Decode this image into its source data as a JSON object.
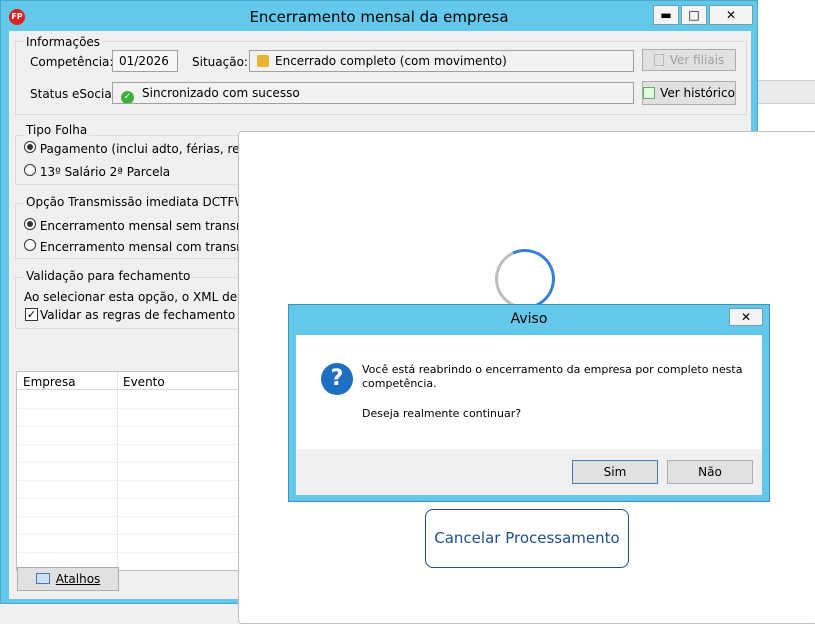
{
  "window": {
    "title": "Encerramento mensal da empresa",
    "minimize": "▬",
    "maximize": "□",
    "close": "✕"
  },
  "info": {
    "group_label": "Informações",
    "competencia_label": "Competência:",
    "competencia_value": "01/2026",
    "situacao_label": "Situação:",
    "situacao_value": "Encerrado completo (com movimento)",
    "ver_filiais": "Ver filiais",
    "status_label": "Status eSocial:",
    "status_value": "Sincronizado com sucesso",
    "ver_historico": "Ver histórico"
  },
  "tipo_folha": {
    "label": "Tipo Folha",
    "option1": "Pagamento (inclui adto, férias, rescisã",
    "option2": "13º Salário 2ª Parcela",
    "selected": 0
  },
  "transmissao": {
    "label": "Opção Transmissão imediata DCTFWeb (",
    "option1": "Encerramento mensal sem transmissã",
    "option2": "Encerramento mensal com transmissã",
    "selected": 0
  },
  "validacao": {
    "label": "Validação para fechamento",
    "text": "Ao selecionar esta opção, o XML de retor",
    "checkbox_label": "Validar as regras de fechamento",
    "checked": true
  },
  "grid": {
    "columns": [
      "Empresa",
      "Evento"
    ]
  },
  "atalhos_label": "Atalhos",
  "overlay": {
    "cancel_label": "Cancelar Processamento"
  },
  "dialog": {
    "title": "Aviso",
    "close": "✕",
    "message_line1": "Você está reabrindo o encerramento da empresa por completo nesta",
    "message_line2": "competência.",
    "question": "Deseja realmente continuar?",
    "yes": "Sim",
    "no": "Não"
  },
  "colors": {
    "title_bar": "#64c8ea",
    "accent": "#1e6fc0",
    "cancel_text": "#1f4e8c"
  }
}
